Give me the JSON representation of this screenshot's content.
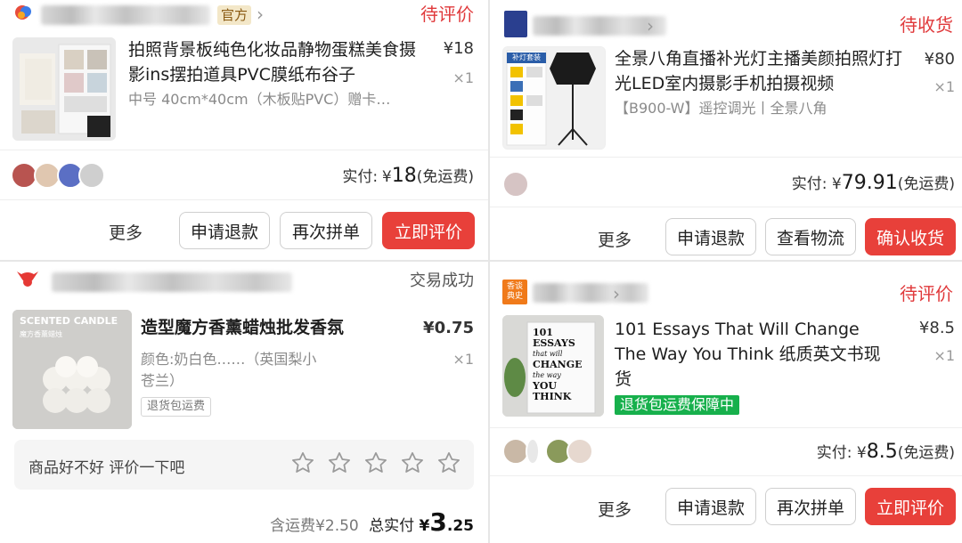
{
  "orders": [
    {
      "shop_badge": "官方",
      "status": "待评价",
      "title": "拍照背景板纯色化妆品静物蛋糕美食摄影ins摆拍道具PVC膜纸布谷子",
      "price": "¥18",
      "qty": "×1",
      "spec": "中号 40cm*40cm（木板贴PVC）赠卡…",
      "paid_label": "实付:",
      "paid_currency": "¥",
      "paid_amount": "18",
      "paid_note": "(免运费)",
      "buttons": {
        "more": "更多",
        "refund": "申请退款",
        "reorder": "再次拼单",
        "review": "立即评价"
      }
    },
    {
      "status": "待收货",
      "title": "全景八角直播补光灯主播美颜拍照灯打光LED室内摄影手机拍摄视频",
      "price": "¥80",
      "qty": "×1",
      "spec": "【B900-W】遥控调光丨全景八角",
      "thumb_label": "补灯套装",
      "paid_label": "实付:",
      "paid_currency": "¥",
      "paid_amount": "79.91",
      "paid_note": "(免运费)",
      "buttons": {
        "more": "更多",
        "refund": "申请退款",
        "logistics": "查看物流",
        "confirm": "确认收货"
      }
    },
    {
      "status": "交易成功",
      "title": "造型魔方香薰蜡烛批发香氛",
      "price_currency": "¥",
      "price_amount": "0.75",
      "qty": "×1",
      "spec": "颜色:奶白色……（英国梨小苍兰）",
      "tag": "退货包运费",
      "thumb_label": "SCENTED CANDLE",
      "thumb_sublabel": "魔方香薰蜡烛",
      "review_prompt": "商品好不好 评价一下吧",
      "stars": 5,
      "shipping_label": "含运费",
      "shipping_value": "¥2.50",
      "total_label": "总实付",
      "total_currency": "¥",
      "total_int": "3",
      "total_dec": ".25"
    },
    {
      "shop_badge": "香谈\n典史",
      "status": "待评价",
      "title": "101 Essays That Will Change The Way You Think 纸质英文书现货",
      "price": "¥8.5",
      "qty": "×1",
      "tag": "退货包运费保障中",
      "book_lines": [
        "101",
        "ESSAYS",
        "that will",
        "CHANGE",
        "the way",
        "YOU",
        "THINK"
      ],
      "paid_label": "实付:",
      "paid_currency": "¥",
      "paid_amount": "8.5",
      "paid_note": "(免运费)",
      "buttons": {
        "more": "更多",
        "refund": "申请退款",
        "reorder": "再次拼单",
        "review": "立即评价"
      }
    }
  ],
  "colors": {
    "accent_red": "#e8403a",
    "status_red": "#e0393b",
    "green_tag": "#17b04c"
  }
}
